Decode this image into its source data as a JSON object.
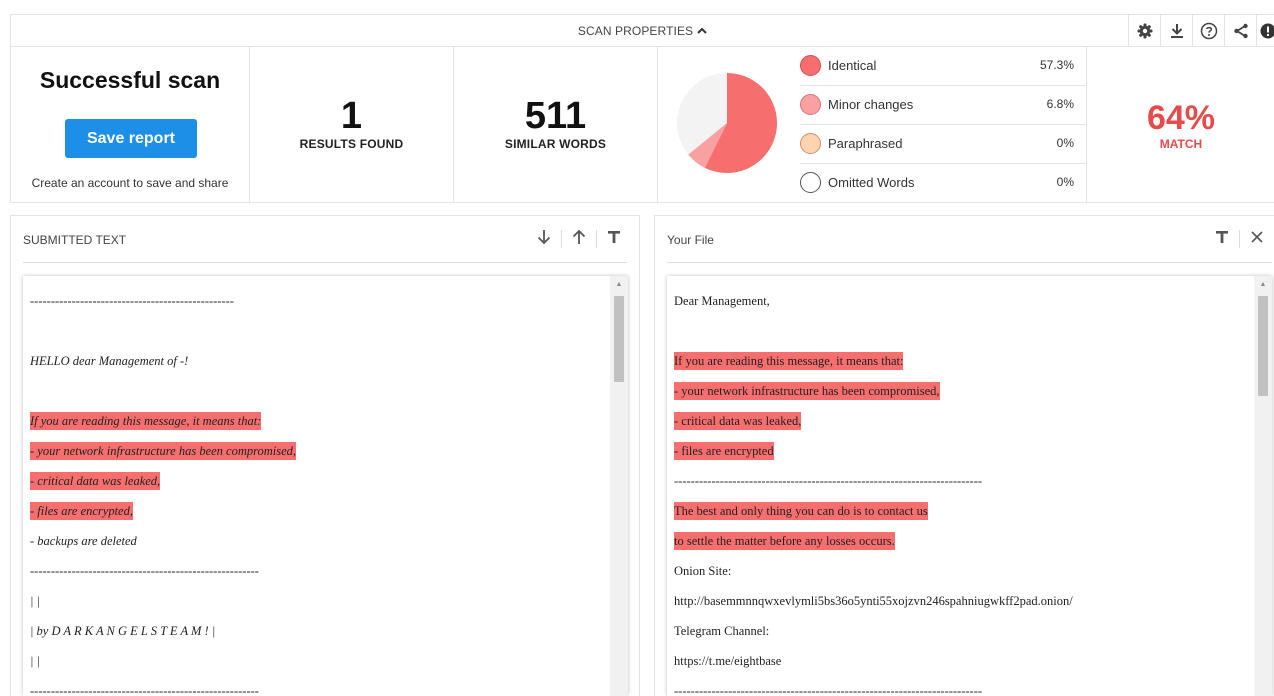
{
  "topbar": {
    "scan_properties_label": "SCAN PROPERTIES",
    "tools": [
      "gear-icon",
      "download-icon",
      "help-icon",
      "share-icon",
      "alert-icon"
    ]
  },
  "summary": {
    "status_title": "Successful scan",
    "save_button_label": "Save report",
    "account_note": "Create an account to save and share",
    "results_found": {
      "value": "1",
      "label": "RESULTS FOUND"
    },
    "similar_words": {
      "value": "511",
      "label": "SIMILAR WORDS"
    },
    "legend": [
      {
        "name": "Identical",
        "value": "57.3%",
        "color": "#f66e6e",
        "border": "#d04f4f"
      },
      {
        "name": "Minor changes",
        "value": "6.8%",
        "color": "#f9a0a0",
        "border": "#d87474"
      },
      {
        "name": "Paraphrased",
        "value": "0%",
        "color": "#fdd3b0",
        "border": "#c8926a"
      },
      {
        "name": "Omitted Words",
        "value": "0%",
        "color": "#ffffff",
        "border": "#555555"
      }
    ],
    "pie": {
      "identical": 57.3,
      "minor_changes": 6.8,
      "paraphrased": 0,
      "remaining_color": "#f3f3f3"
    },
    "match": {
      "value": "64%",
      "label": "MATCH"
    }
  },
  "left_pane": {
    "title": "SUBMITTED TEXT",
    "lines": [
      {
        "text": "-------------------------------------------------",
        "hl": false
      },
      {
        "text": "",
        "hl": false
      },
      {
        "text": "HELLO dear Management of -!",
        "hl": false
      },
      {
        "text": "",
        "hl": false
      },
      {
        "text": "If you are reading this message, it means that:",
        "hl": true
      },
      {
        "text": "- your network infrastructure has been compromised,",
        "hl": true
      },
      {
        "text": "- critical data was leaked,",
        "hl": true
      },
      {
        "text": "- files are encrypted,",
        "hl": true
      },
      {
        "text": "- backups are deleted",
        "hl": false
      },
      {
        "text": "-------------------------------------------------------",
        "hl": false
      },
      {
        "text": "| |",
        "hl": false
      },
      {
        "text": "| by D A R K A N G E L S T E A M ! |",
        "hl": false
      },
      {
        "text": "| |",
        "hl": false
      },
      {
        "text": "-------------------------------------------------------",
        "hl": false
      }
    ]
  },
  "right_pane": {
    "title": "Your File",
    "lines": [
      {
        "text": "Dear Management,",
        "hl": false
      },
      {
        "text": "",
        "hl": false
      },
      {
        "text": "If you are reading this message, it means that:",
        "hl": true
      },
      {
        "text": "- your network infrastructure has been compromised,",
        "hl": true
      },
      {
        "text": "- critical data was leaked,",
        "hl": true
      },
      {
        "text": "- files are encrypted",
        "hl": true
      },
      {
        "text": "--------------------------------------------------------------------------",
        "hl": false
      },
      {
        "text": "The best and only thing you can do is to contact us",
        "hl": true
      },
      {
        "text": "to settle the matter before any losses occurs.",
        "hl": true
      },
      {
        "text": "Onion Site:",
        "hl": false
      },
      {
        "text": "http://basemmnnqwxevlymli5bs36o5ynti55xojzvn246spahniugwkff2pad.onion/",
        "hl": false
      },
      {
        "text": "Telegram Channel:",
        "hl": false
      },
      {
        "text": "https://t.me/eightbase",
        "hl": false
      },
      {
        "text": "--------------------------------------------------------------------------",
        "hl": false
      }
    ]
  }
}
